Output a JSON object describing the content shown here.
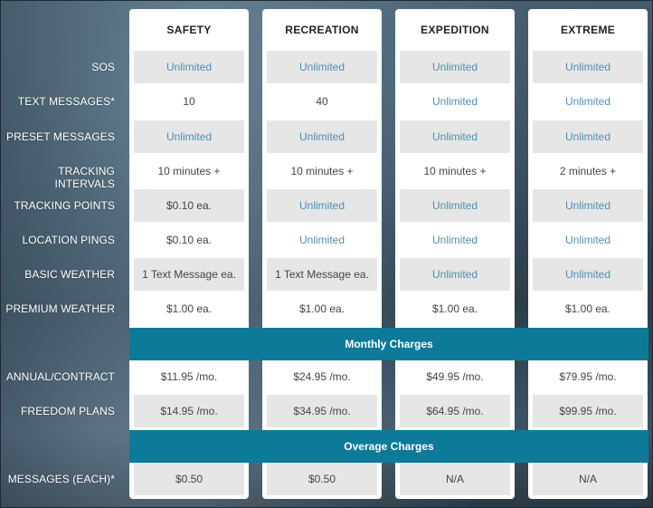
{
  "plans": [
    "SAFETY",
    "RECREATION",
    "EXPEDITION",
    "EXTREME"
  ],
  "rows": [
    {
      "label": "SOS",
      "values": [
        "Unlimited",
        "Unlimited",
        "Unlimited",
        "Unlimited"
      ]
    },
    {
      "label": "TEXT MESSAGES*",
      "values": [
        "10",
        "40",
        "Unlimited",
        "Unlimited"
      ]
    },
    {
      "label": "PRESET MESSAGES",
      "values": [
        "Unlimited",
        "Unlimited",
        "Unlimited",
        "Unlimited"
      ]
    },
    {
      "label": "TRACKING INTERVALS",
      "values": [
        "10 minutes +",
        "10 minutes +",
        "10 minutes +",
        "2 minutes +"
      ]
    },
    {
      "label": "TRACKING POINTS",
      "values": [
        "$0.10 ea.",
        "Unlimited",
        "Unlimited",
        "Unlimited"
      ]
    },
    {
      "label": "LOCATION PINGS",
      "values": [
        "$0.10 ea.",
        "Unlimited",
        "Unlimited",
        "Unlimited"
      ]
    },
    {
      "label": "BASIC WEATHER",
      "values": [
        "1 Text Message ea.",
        "1 Text Message ea.",
        "Unlimited",
        "Unlimited"
      ]
    },
    {
      "label": "PREMIUM WEATHER",
      "values": [
        "$1.00 ea.",
        "$1.00 ea.",
        "$1.00 ea.",
        "$1.00 ea."
      ]
    }
  ],
  "monthly_band": "Monthly Charges",
  "monthly_rows": [
    {
      "label": "ANNUAL/CONTRACT",
      "values": [
        "$11.95 /mo.",
        "$24.95 /mo.",
        "$49.95 /mo.",
        "$79.95 /mo."
      ]
    },
    {
      "label": "FREEDOM PLANS",
      "values": [
        "$14.95 /mo.",
        "$34.95 /mo.",
        "$64.95 /mo.",
        "$99.95 /mo."
      ]
    }
  ],
  "overage_band": "Overage Charges",
  "overage_rows": [
    {
      "label": "MESSAGES (EACH)*",
      "values": [
        "$0.50",
        "$0.50",
        "N/A",
        "N/A"
      ]
    }
  ],
  "colors": {
    "band": "#0d7a9a",
    "link_text": "#4f8fb0",
    "shaded_cell": "#e6e6e6"
  }
}
